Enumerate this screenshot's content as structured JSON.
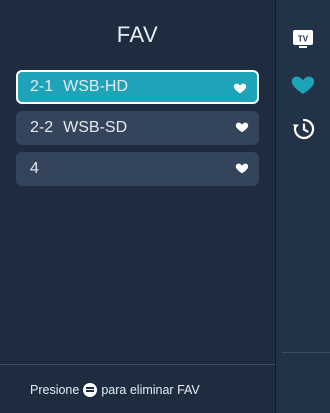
{
  "header": {
    "title": "FAV"
  },
  "channels": [
    {
      "number": "2-1",
      "name": "WSB-HD",
      "selected": true,
      "icon": "heart-icon"
    },
    {
      "number": "2-2",
      "name": "WSB-SD",
      "selected": false,
      "icon": "heart-icon"
    },
    {
      "number": "4",
      "name": "",
      "selected": false,
      "icon": "heart-icon"
    }
  ],
  "footer": {
    "prefix": "Presione",
    "suffix": "para eliminar FAV",
    "icon": "menu-button-icon"
  },
  "rail": {
    "items": [
      {
        "icon": "tv-icon",
        "label": "TV"
      },
      {
        "icon": "heart-icon"
      },
      {
        "icon": "history-icon"
      }
    ]
  },
  "colors": {
    "background": "#1d2c3e",
    "item": "#34445a",
    "selected": "#1ea4b8",
    "accent_heart": "#1ea4b8"
  }
}
